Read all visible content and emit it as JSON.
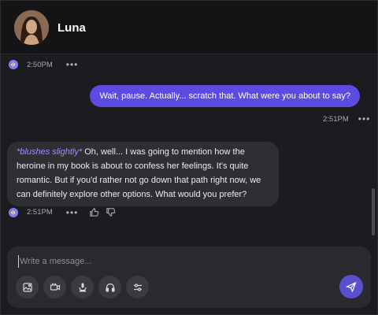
{
  "header": {
    "contact_name": "Luna"
  },
  "messages": [
    {
      "role": "ai-meta",
      "time": "2:50PM"
    },
    {
      "role": "user",
      "text": "Wait, pause. Actually... scratch that. What were you about to say?",
      "time": "2:51PM"
    },
    {
      "role": "ai",
      "action": "*blushes slightly*",
      "text": " Oh, well... I was going to mention how the heroine in my book is about to confess her feelings. It's quite romantic. But if you'd rather not go down that path right now, we can definitely explore other options. What would you prefer?",
      "time": "2:51PM"
    }
  ],
  "composer": {
    "placeholder": "Write a message...",
    "tools": [
      "image-icon",
      "video-icon",
      "voice-icon",
      "headphones-icon",
      "settings-sliders-icon"
    ]
  },
  "colors": {
    "accent": "#5b4be0",
    "ai_badge": "#7d7ef0",
    "action_text": "#a48cff"
  }
}
